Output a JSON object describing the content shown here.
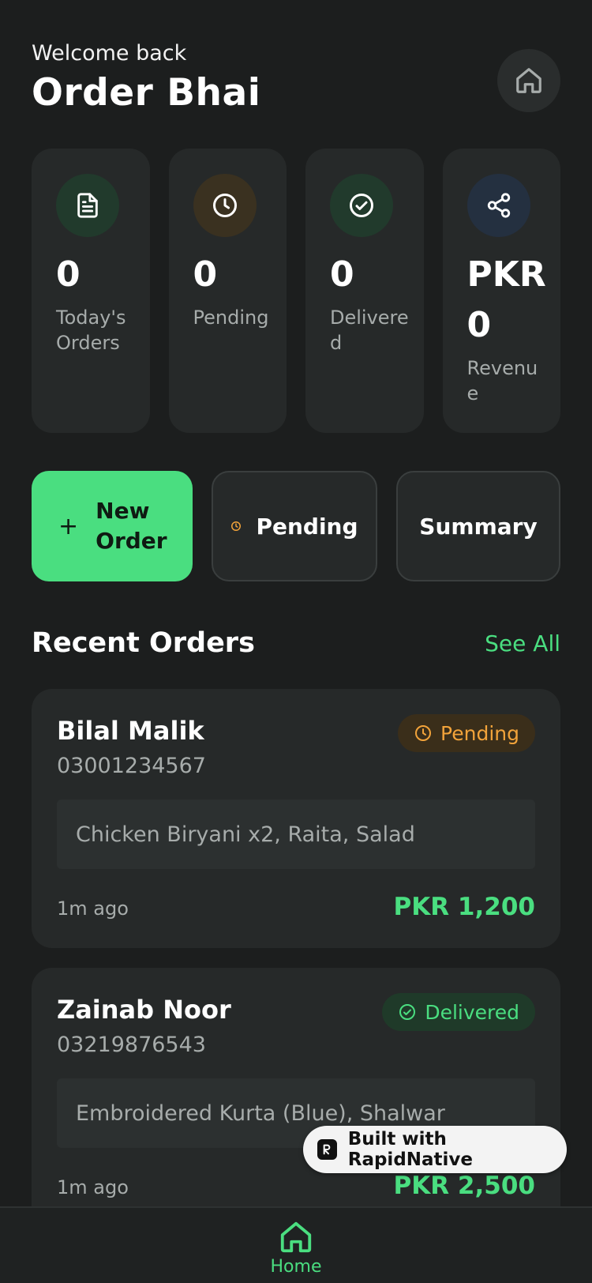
{
  "header": {
    "welcome": "Welcome back",
    "title": "Order Bhai"
  },
  "stats": [
    {
      "value": "0",
      "label": "Today's Orders",
      "icon": "document-icon",
      "bg": "#213a2c",
      "fg": "#ffffff"
    },
    {
      "value": "0",
      "label": "Pending",
      "icon": "clock-icon",
      "bg": "#3a3120",
      "fg": "#ffffff"
    },
    {
      "value": "0",
      "label": "Delivered",
      "icon": "check-circle-icon",
      "bg": "#213a2c",
      "fg": "#ffffff"
    },
    {
      "value": "PKR 0",
      "label": "Revenue",
      "icon": "share-icon",
      "bg": "#243040",
      "fg": "#ffffff"
    }
  ],
  "actions": {
    "new_order": "New Order",
    "pending": "Pending",
    "summary": "Summary"
  },
  "recent": {
    "title": "Recent Orders",
    "see_all": "See All"
  },
  "orders": [
    {
      "name": "Bilal Malik",
      "phone": "03001234567",
      "status": "Pending",
      "items": "Chicken Biryani x2, Raita, Salad",
      "time": "1m ago",
      "amount": "PKR 1,200"
    },
    {
      "name": "Zainab Noor",
      "phone": "03219876543",
      "status": "Delivered",
      "items": "Embroidered Kurta (Blue), Shalwar",
      "time": "1m ago",
      "amount": "PKR 2,500"
    }
  ],
  "tabbar": {
    "home": "Home"
  },
  "badge": {
    "text": "Built with RapidNative"
  },
  "colors": {
    "accent": "#4ade80",
    "pending": "#f2a33a",
    "background": "#1c1e1e",
    "card": "#262929"
  }
}
